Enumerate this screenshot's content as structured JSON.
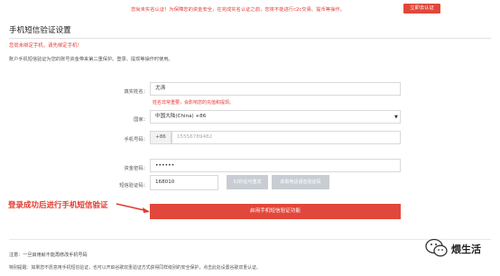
{
  "notice": {
    "text": "您尚未实名认证！为保障您的资金安全，在完成实名认证之前，您将不能进行c2c交易、提币等操作。",
    "button_label": "立即去认证"
  },
  "page_title": "手机短信验证设置",
  "warning": "您尚未绑定手机，请先绑定手机！",
  "description": "账户手机短信验证为您的账号资金带来第二重保护。登录、提现等操作时使用。",
  "form": {
    "realname": {
      "label": "真实姓名：",
      "value": "尤涛",
      "hint": "姓名非常重要，会影响您的充值和提现。"
    },
    "country": {
      "label": "国家：",
      "value": "中国大陆(China) +86"
    },
    "phone": {
      "label": "手机号码：",
      "prefix": "+86",
      "placeholder": "15556789482"
    },
    "password": {
      "label": "资金密码：",
      "value": "••••••"
    },
    "smscode": {
      "label": "短信验证码：",
      "value": "168010",
      "resend_label": "52秒后可重发",
      "voice_label": "获取电话语音验证码"
    },
    "submit_label": "启用手机短信验证功能"
  },
  "annotation": "登录成功后进行手机短信验证",
  "note": "注意：一旦启用就不能再修改手机号码",
  "tip": "特别提醒：如果您不愿意用手机短信验证，也可以开启谷歌双重验证方式获得同样级别的安全保护，点击此处设置谷歌双重认证。",
  "watermark": {
    "icon": "wechat-icon",
    "text": "煨生活"
  },
  "colors": {
    "accent": "#e2473b",
    "warning_text": "#e43b36",
    "disabled_button": "#c8cdd3"
  }
}
